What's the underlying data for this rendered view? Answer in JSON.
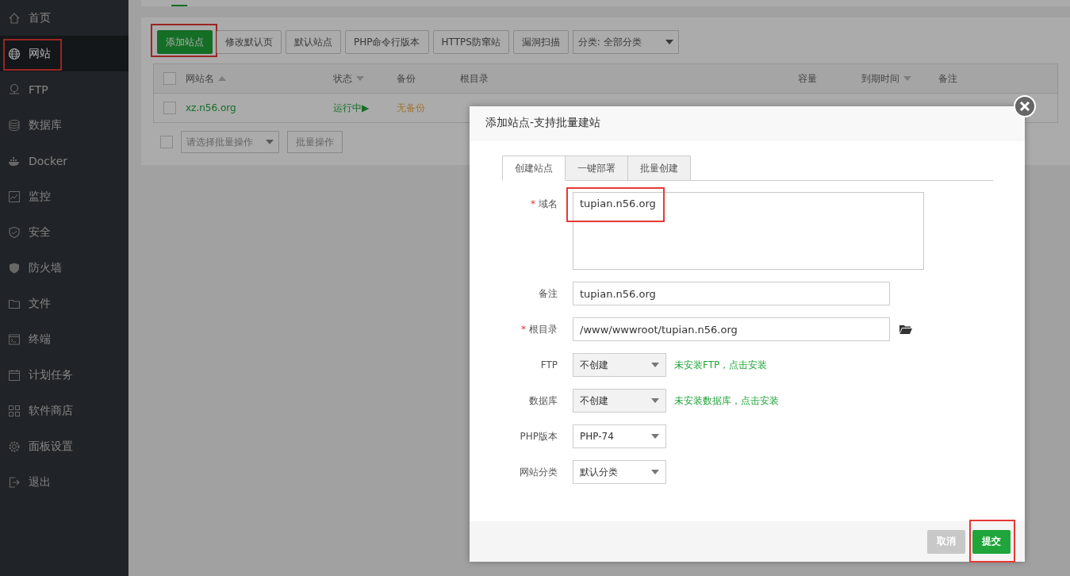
{
  "sidebar": {
    "items": [
      {
        "label": "首页",
        "selected": false,
        "annotated": false
      },
      {
        "label": "网站",
        "selected": true,
        "annotated": true
      },
      {
        "label": "FTP",
        "selected": false,
        "annotated": false
      },
      {
        "label": "数据库",
        "selected": false,
        "annotated": false
      },
      {
        "label": "Docker",
        "selected": false,
        "annotated": false
      },
      {
        "label": "监控",
        "selected": false,
        "annotated": false
      },
      {
        "label": "安全",
        "selected": false,
        "annotated": false
      },
      {
        "label": "防火墙",
        "selected": false,
        "annotated": false
      },
      {
        "label": "文件",
        "selected": false,
        "annotated": false
      },
      {
        "label": "终端",
        "selected": false,
        "annotated": false
      },
      {
        "label": "计划任务",
        "selected": false,
        "annotated": false
      },
      {
        "label": "软件商店",
        "selected": false,
        "annotated": false
      },
      {
        "label": "面板设置",
        "selected": false,
        "annotated": false
      },
      {
        "label": "退出",
        "selected": false,
        "annotated": false
      }
    ]
  },
  "toolbar": {
    "buttons": [
      {
        "label": "添加站点",
        "kind": "primary",
        "annotated": true
      },
      {
        "label": "修改默认页",
        "kind": "plain",
        "annotated": false
      },
      {
        "label": "默认站点",
        "kind": "plain",
        "annotated": false
      },
      {
        "label": "PHP命令行版本",
        "kind": "plain",
        "annotated": false
      },
      {
        "label": "HTTPS防窜站",
        "kind": "plain",
        "annotated": false
      },
      {
        "label": "漏洞扫描",
        "kind": "plain",
        "annotated": false
      }
    ],
    "category": {
      "value": "分类: 全部分类"
    }
  },
  "table": {
    "all_checked": false,
    "columns": [
      {
        "label": "网站名",
        "sort_up": true,
        "sort_down": false
      },
      {
        "label": "状态",
        "sort_up": false,
        "sort_down": true
      },
      {
        "label": "备份",
        "sort_up": false,
        "sort_down": false
      },
      {
        "label": "根目录",
        "sort_up": false,
        "sort_down": false
      },
      {
        "label": "容量",
        "sort_up": false,
        "sort_down": false
      },
      {
        "label": "到期时间",
        "sort_up": false,
        "sort_down": true
      },
      {
        "label": "备注",
        "sort_up": false,
        "sort_down": false
      }
    ],
    "rows": [
      {
        "checked": false,
        "name": "xz.n56.org",
        "status": "运行中▶",
        "backup": "无备份"
      }
    ],
    "batch": {
      "checked": false,
      "placeholder": "请选择批量操作",
      "button": "批量操作"
    }
  },
  "dialog": {
    "title": "添加站点-支持批量建站",
    "tabs": [
      {
        "label": "创建站点",
        "selected": true
      },
      {
        "label": "一键部署",
        "selected": false
      },
      {
        "label": "批量创建",
        "selected": false
      }
    ],
    "fields": [
      {
        "kind": "textarea",
        "label": "域名",
        "required_mark": "*",
        "value": "tupian.n56.org",
        "annotated": true
      },
      {
        "kind": "input",
        "label": "备注",
        "value": "tupian.n56.org",
        "annotated": false
      },
      {
        "kind": "path",
        "label": "根目录",
        "required_mark": "*",
        "value": "/www/wwwroot/tupian.n56.org",
        "annotated": false
      },
      {
        "kind": "select",
        "label": "FTP",
        "value": "不创建",
        "disabled": true,
        "hint": "未安装FTP，点击安装",
        "annotated": false
      },
      {
        "kind": "select",
        "label": "数据库",
        "value": "不创建",
        "disabled": true,
        "hint": "未安装数据库，点击安装",
        "annotated": false
      },
      {
        "kind": "select",
        "label": "PHP版本",
        "value": "PHP-74",
        "disabled": false,
        "annotated": false
      },
      {
        "kind": "select",
        "label": "网站分类",
        "value": "默认分类",
        "disabled": false,
        "annotated": false
      }
    ],
    "buttons": [
      {
        "label": "取消",
        "kind": "cancel",
        "annotated": false
      },
      {
        "label": "提交",
        "kind": "submit",
        "annotated": true
      }
    ]
  }
}
